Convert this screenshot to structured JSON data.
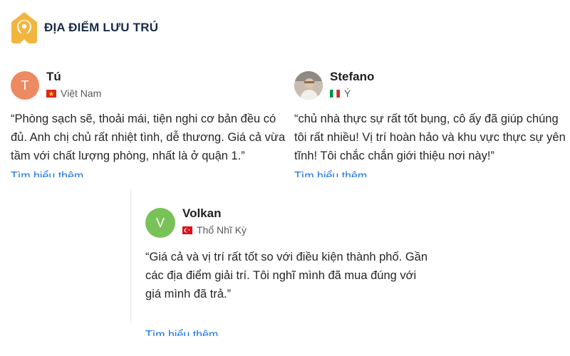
{
  "header": {
    "title": "ĐỊA ĐIỂM LƯU TRÚ",
    "icon": "home-pin-icon",
    "accent": "#f2b640"
  },
  "reviews": [
    {
      "initial": "T",
      "name": "Tú",
      "country": "Việt Nam",
      "flag": "vietnam-flag-icon",
      "text": "“Phòng sạch sẽ, thoải mái, tiện nghi cơ bản đều có đủ. Anh chị chủ rất nhiệt tình, dễ thương. Giá cả vừa tầm với chất lượng phòng, nhất là ở quận 1.”",
      "more": "Tìm hiểu thêm"
    },
    {
      "name": "Stefano",
      "country": "Ý",
      "flag": "italy-flag-icon",
      "text": "“chủ nhà thực sự rất tốt bụng, cô ấy đã giúp chúng tôi rất nhiều! Vị trí hoàn hảo và khu vực thực sự yên tĩnh! Tôi chắc chắn giới thiệu nơi này!”",
      "more": "Tìm hiểu thêm"
    },
    {
      "initial": "V",
      "name": "Volkan",
      "country": "Thổ Nhĩ Kỳ",
      "flag": "turkey-flag-icon",
      "text": "“Giá cả và vị trí rất tốt so với điều kiện thành phố. Gần các địa điểm giải trí. Tôi nghĩ mình đã mua đúng với giá mình đã trả.”",
      "more": "Tìm hiểu thêm"
    }
  ],
  "colors": {
    "link": "#1a73e8",
    "avatar_t": "#ee8a62",
    "avatar_v": "#79c257"
  }
}
